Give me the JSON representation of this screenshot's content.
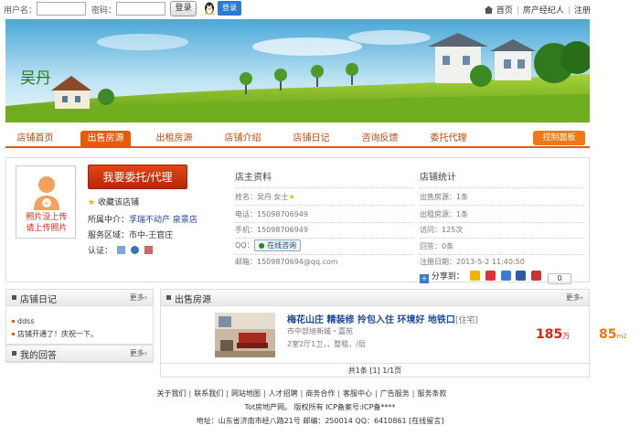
{
  "topbar": {
    "username_label": "用户名：",
    "password_label": "密码：",
    "login_button": "登录",
    "qq_login": "登录",
    "links": [
      "首页",
      "房产经纪人",
      "注册"
    ]
  },
  "shop": {
    "name": "吴丹"
  },
  "nav": {
    "items": [
      "店铺首页",
      "出售房源",
      "出租房源",
      "店铺介绍",
      "店铺日记",
      "咨询反馈",
      "委托代理"
    ],
    "active": "出售房源",
    "control_panel": "控制面板"
  },
  "profile": {
    "photo_text_1": "照片没上传",
    "photo_text_2": "请上传照片",
    "entrust_button": "我要委托/代理",
    "favorite": "收藏该店铺",
    "agency_label": "所属中介：",
    "agency_value": "孚瑞不动产 泉景店",
    "area_label": "服务区域：",
    "area_value": "市中-王官庄",
    "cert_label": "认证："
  },
  "owner": {
    "title": "店主资料",
    "name_label": "姓名：",
    "name_value": "吴丹 女士",
    "phone_label": "电话：",
    "phone_value": "15098706949",
    "mobile_label": "手机：",
    "mobile_value": "15098706949",
    "qq_label": "QQ：",
    "online_button": "在线咨询",
    "email_label": "邮箱：",
    "email_value": "1509870694@qq.com"
  },
  "stats": {
    "title": "店铺统计",
    "sale_label": "出售房源：",
    "sale_value": "1条",
    "rent_label": "出租房源：",
    "rent_value": "1条",
    "visits_label": "访问：",
    "visits_value": "125次",
    "answers_label": "回答：",
    "answers_value": "0条",
    "reg_label": "注册日期：",
    "reg_value": "2013-5-2 11:40:50"
  },
  "share": {
    "label": "分享到：",
    "count": "0"
  },
  "diary": {
    "title": "店铺日记",
    "more": "更多",
    "items": [
      "ddss",
      "店铺开通了！庆祝一下。"
    ]
  },
  "answers_box": {
    "title": "我的回答",
    "more": "更多"
  },
  "sale_box": {
    "title": "出售房源",
    "more": "更多"
  },
  "listing": {
    "title": "梅花山庄 精装修 拎包入住 环境好 地铁口",
    "tag": "[住宅]",
    "address": "市中部旭新城・嘉苑",
    "info": "2室2厅1卫，，整租，/层",
    "price": "185",
    "price_unit": "万",
    "area": "85",
    "area_unit": "m2"
  },
  "pager": "共1条 [1] 1/1页",
  "footer": {
    "links": [
      "关于我们",
      "联系我们",
      "网站地图",
      "人才招聘",
      "商务合作",
      "客服中心",
      "广告服务",
      "服务条款"
    ],
    "copyright": "Tot房地产网。 版权所有 ICP备案号:ICP备****",
    "address": "地址：山东省济南市经八路21号 邮编：250014 QQ：6410861 [在线留言]"
  },
  "colors": {
    "accent": "#e8590c",
    "link": "#1a4aa0",
    "price": "#dd2211"
  }
}
